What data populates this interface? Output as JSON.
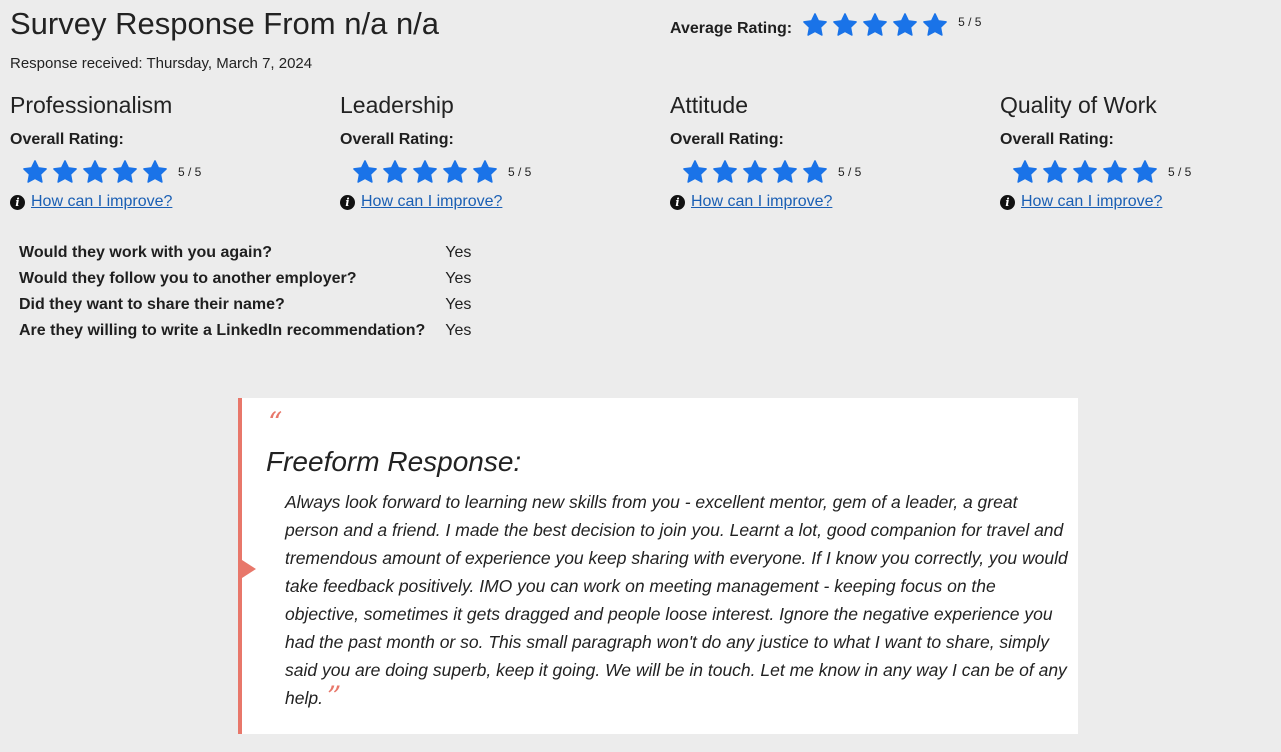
{
  "header": {
    "title": "Survey Response From n/a n/a",
    "received": "Response received: Thursday, March 7, 2024",
    "average_label": "Average Rating:",
    "average_value": 5,
    "average_score": "5 / 5"
  },
  "categories": [
    {
      "title": "Professionalism",
      "overall_label": "Overall Rating:",
      "rating": 5,
      "score": "5 / 5",
      "improve_link": "How can I improve?"
    },
    {
      "title": "Leadership",
      "overall_label": "Overall Rating:",
      "rating": 5,
      "score": "5 / 5",
      "improve_link": "How can I improve?"
    },
    {
      "title": "Attitude",
      "overall_label": "Overall Rating:",
      "rating": 5,
      "score": "5 / 5",
      "improve_link": "How can I improve?"
    },
    {
      "title": "Quality of Work",
      "overall_label": "Overall Rating:",
      "rating": 5,
      "score": "5 / 5",
      "improve_link": "How can I improve?"
    }
  ],
  "questions": [
    {
      "q": "Would they work with you again?",
      "a": "Yes"
    },
    {
      "q": "Would they follow you to another employer?",
      "a": "Yes"
    },
    {
      "q": "Did they want to share their name?",
      "a": "Yes"
    },
    {
      "q": "Are they willing to write a LinkedIn recommendation?",
      "a": "Yes"
    }
  ],
  "freeform": {
    "open_quote": "“",
    "heading": "Freeform Response:",
    "text": "Always look forward to learning new skills from you - excellent mentor, gem of a leader, a great person and a friend. I made the best decision to join you. Learnt a lot, good companion for travel and tremendous amount of experience you keep sharing with everyone. If I know you correctly, you would take feedback positively. IMO you can work on meeting management - keeping focus on the objective, sometimes it gets dragged and people loose interest. Ignore the negative experience you had the past month or so. This small paragraph won't do any justice to what I want to share, simply said you are doing superb, keep it going. We will be in touch. Let me know in any way I can be of any help.",
    "close_quote": "”"
  },
  "colors": {
    "star": "#1a73e8",
    "accent": "#e8776a",
    "link": "#1a5fb4"
  },
  "icons": {
    "star": "star-icon",
    "info": "info-icon"
  }
}
